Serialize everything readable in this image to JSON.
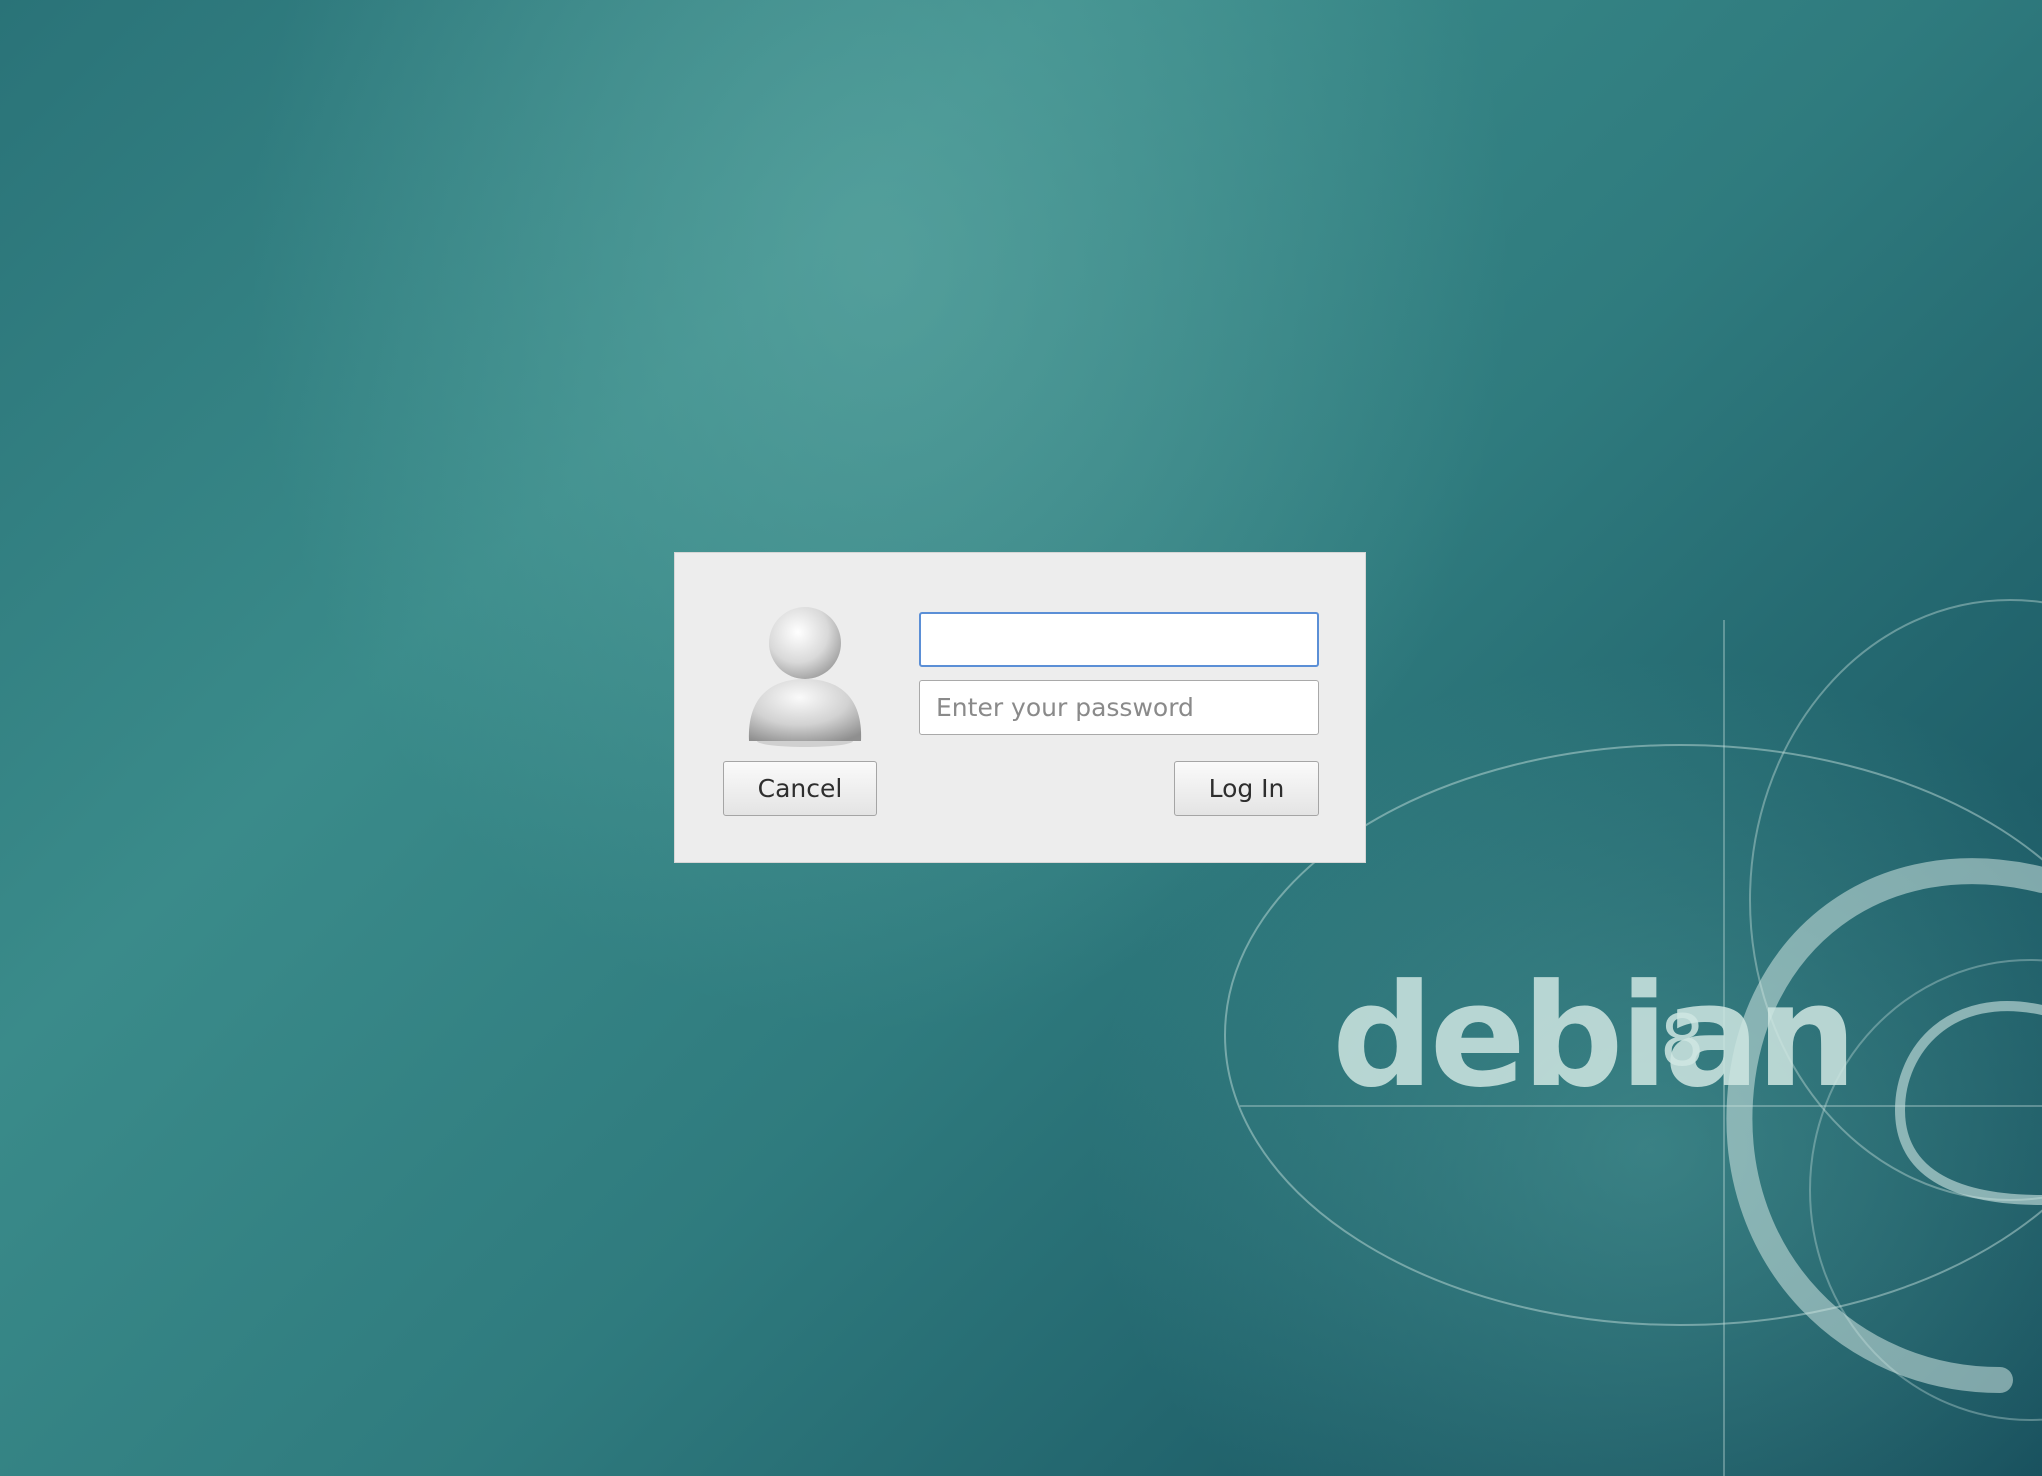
{
  "wallpaper": {
    "brand": "debian",
    "version": "8",
    "colors": {
      "background_light": "#3f8f8d",
      "background_dark": "#18505d",
      "art_line": "#cfe6e2"
    }
  },
  "login": {
    "avatar_icon": "user-avatar-icon",
    "username_value": "",
    "password_placeholder": "Enter your password",
    "cancel_label": "Cancel",
    "login_label": "Log In",
    "focus_color": "#5b8fd6",
    "dialog_background": "#ededed"
  }
}
